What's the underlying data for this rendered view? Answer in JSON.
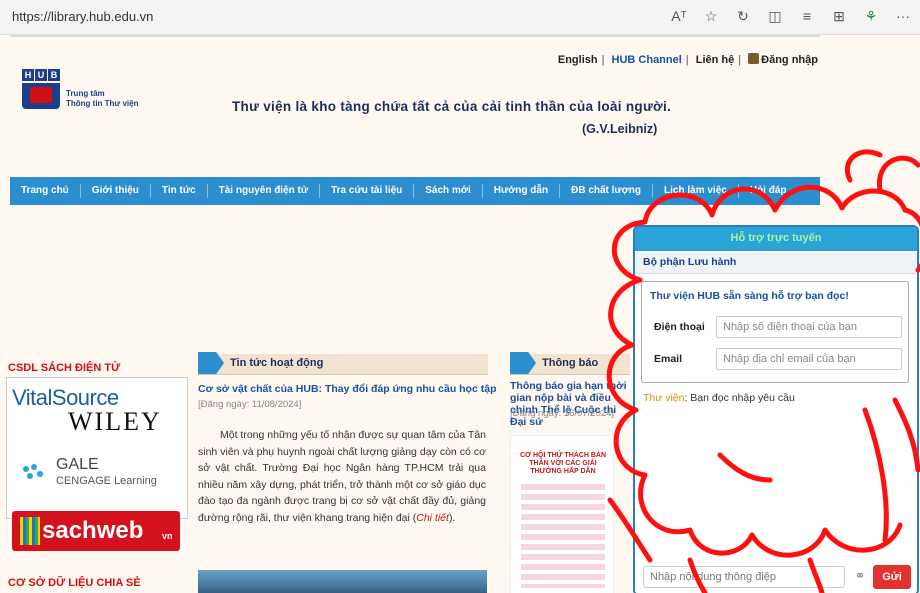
{
  "browser": {
    "url": "https://library.hub.edu.vn",
    "icons": [
      "read-aloud-icon",
      "favorite-star-icon",
      "extensions-icon",
      "split-screen-icon",
      "favorites-icon",
      "collections-icon",
      "performance-icon",
      "more-icon"
    ],
    "icon_glyphs": [
      "Aᵀ",
      "☆",
      "↻",
      "◫",
      "≡",
      "⊞",
      "⚘",
      "···"
    ]
  },
  "header": {
    "links": {
      "english": "English",
      "hub_channel": "HUB Channel",
      "contact": "Liên hệ",
      "login": "Đăng nhập"
    },
    "logo_letters": [
      "H",
      "U",
      "B"
    ],
    "logo_line1": "Trung tâm",
    "logo_line2": "Thông tin Thư viện",
    "slogan": "Thư viện là kho tàng chứa tất cả của cải tinh thần của loài người.",
    "author": "(G.V.Leibniz)"
  },
  "nav": {
    "items": [
      "Trang chủ",
      "Giới thiệu",
      "Tin tức",
      "Tài nguyên điện tử",
      "Tra cứu tài liệu",
      "Sách mới",
      "Hướng dẫn",
      "ĐB chất lượng",
      "Lịch làm việc",
      "Hỏi đáp"
    ]
  },
  "sidebar": {
    "ebook_title": "CSDL SÁCH ĐIỆN TỬ",
    "vitalsource": "VitalSource",
    "wiley": "WILEY",
    "gale": "GALE",
    "cengage": "CENGAGE Learning",
    "sachweb": "sachweb",
    "sachweb_suffix": "vn",
    "shared_title": "CƠ SỞ DỮ LIỆU CHIA SẺ"
  },
  "news": {
    "section_title": "Tin tức hoạt động",
    "title": "Cơ sở vật chất của HUB: Thay đổi đáp ứng nhu cầu học tập",
    "date": "[Đăng ngày: 11/08/2024]",
    "body": "Một trong những yếu tố nhận được sự quan tâm của Tân sinh viên và phụ huynh ngoài chất lượng giảng dạy còn có cơ sở vật chất. Trường Đại học Ngân hàng TP.HCM trải qua nhiều năm xây dựng, phát triển, trở thành một cơ sở giáo dục đào tạo đa ngành được trang bị cơ sở vật chất đầy đủ, giảng đường rộng rãi, thư viện khang trang hiện đại (",
    "more": "Chi tiết",
    "body_end": ")."
  },
  "announce": {
    "section_title": "Thông báo",
    "title": "Thông báo gia hạn thời gian nộp bài và điều chỉnh Thể lệ Cuộc thi Đại sứ",
    "date": "[Đăng ngày: 16/07/2024]",
    "poster_heading": "CƠ HỘI THỬ THÁCH BẢN THÂN VỚI CÁC GIẢI THƯỞNG HẤP DẪN"
  },
  "chat": {
    "header": "Hỗ trợ trực tuyến",
    "department": "Bộ phận Lưu hành",
    "form_heading": "Thư viện HUB sẵn sàng hỗ trợ bạn đọc!",
    "phone_label": "Điện thoại",
    "phone_placeholder": "Nhập số điện thoại của bạn",
    "email_label": "Email",
    "email_placeholder": "Nhập địa chỉ email của bạn",
    "msg_sender": "Thư viện",
    "msg_text": ": Bạn đọc nhập yêu cầu",
    "input_placeholder": "Nhập nội dung thông điệp",
    "attach_icon": "paperclip-icon",
    "send_label": "Gửi"
  },
  "colors": {
    "nav": "#2a8ecf",
    "accent_red": "#e53030",
    "doodle": "#ff1010"
  }
}
